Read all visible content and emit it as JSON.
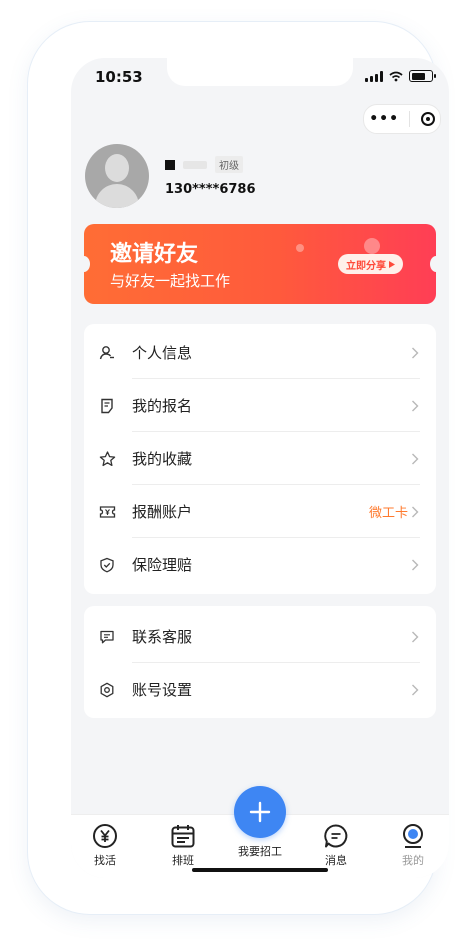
{
  "status_bar": {
    "time": "10:53"
  },
  "profile": {
    "level_tag": "初级",
    "phone": "130****6786"
  },
  "banner": {
    "title": "邀请好友",
    "subtitle": "与好友一起找工作",
    "share_label": "立即分享"
  },
  "menu": [
    {
      "label": "个人信息",
      "icon": "person-icon"
    },
    {
      "label": "我的报名",
      "icon": "document-icon"
    },
    {
      "label": "我的收藏",
      "icon": "star-icon"
    },
    {
      "label": "报酬账户",
      "icon": "ticket-icon",
      "extra": "微工卡"
    },
    {
      "label": "保险理赔",
      "icon": "shield-icon"
    }
  ],
  "menu2": [
    {
      "label": "联系客服",
      "icon": "chat-icon"
    },
    {
      "label": "账号设置",
      "icon": "settings-icon"
    }
  ],
  "tabs": [
    {
      "label": "找活",
      "icon": "yen-icon"
    },
    {
      "label": "排班",
      "icon": "calendar-icon"
    },
    {
      "label": "我要招工",
      "icon": "plus-icon"
    },
    {
      "label": "消息",
      "icon": "message-icon"
    },
    {
      "label": "我的",
      "icon": "profile-icon"
    }
  ],
  "colors": {
    "accent": "#3e86f3",
    "banner_start": "#ff6d35",
    "banner_end": "#ff3e55",
    "extra_text": "#ff7a2e"
  }
}
